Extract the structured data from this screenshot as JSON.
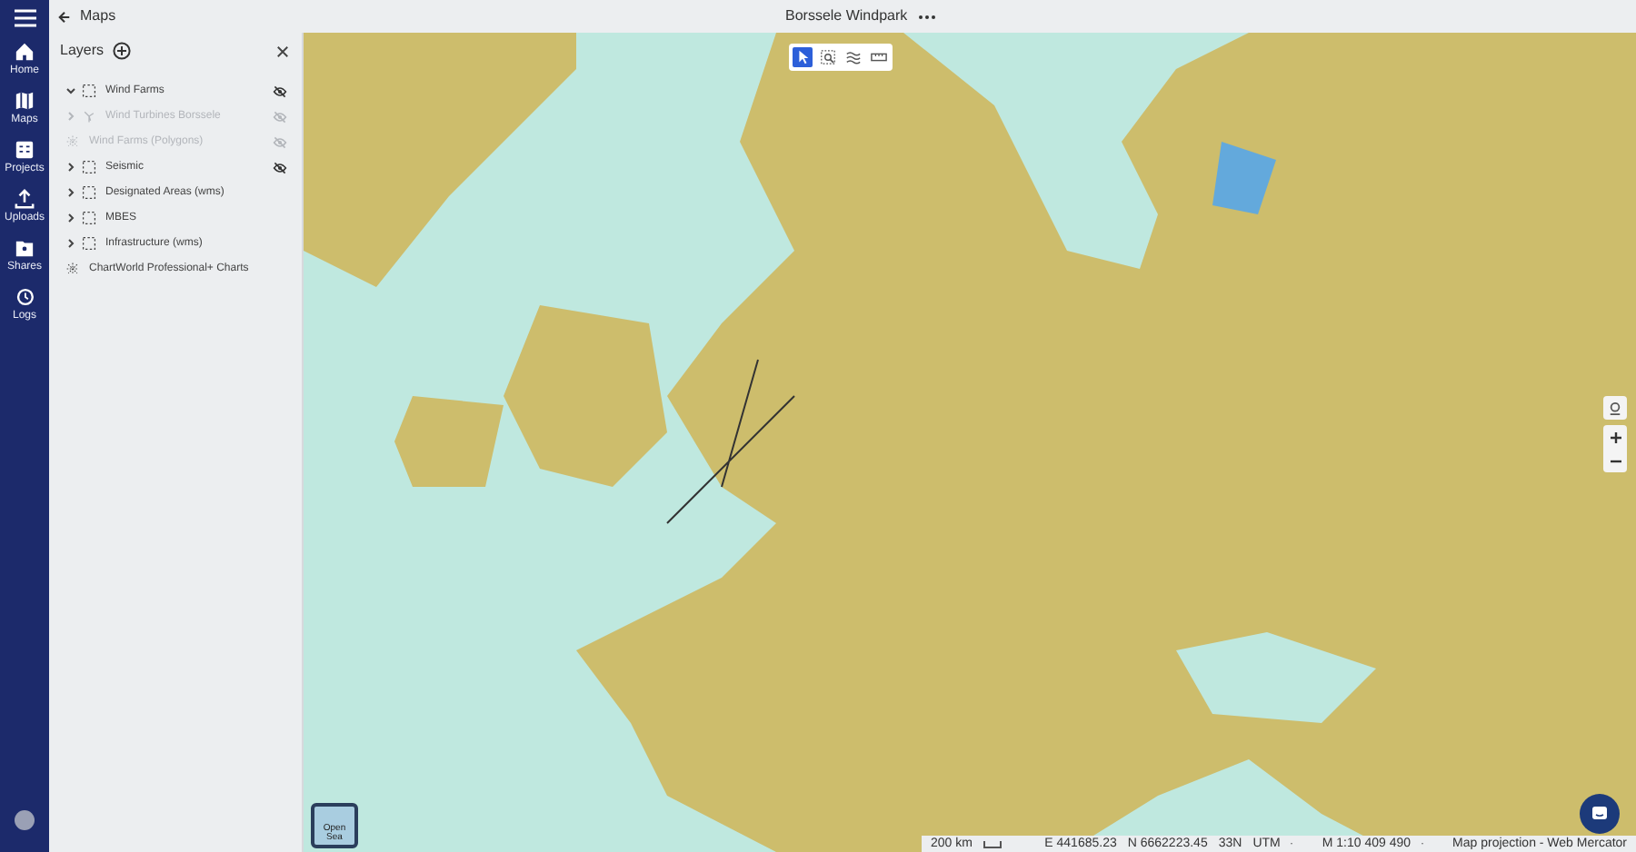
{
  "header": {
    "back_label": "Maps",
    "title": "Borssele Windpark"
  },
  "nav": [
    {
      "label": "Home",
      "kind": "home"
    },
    {
      "label": "Maps",
      "kind": "map"
    },
    {
      "label": "Projects",
      "kind": "projects"
    },
    {
      "label": "Uploads",
      "kind": "upload"
    },
    {
      "label": "Shares",
      "kind": "share"
    },
    {
      "label": "Logs",
      "kind": "history"
    }
  ],
  "layers_panel": {
    "title": "Layers",
    "items": [
      {
        "label": "Wind Farms",
        "kind": "layer",
        "expanded": true,
        "disabled": false,
        "hidden": true
      },
      {
        "label": "Wind Turbines Borssele",
        "kind": "point",
        "expanded": false,
        "disabled": true,
        "hidden": true
      },
      {
        "label": "Wind Farms (Polygons)",
        "kind": "chart",
        "disabled": true,
        "hidden": true
      },
      {
        "label": "Seismic",
        "kind": "layer",
        "expanded": false,
        "disabled": false,
        "hidden": true
      },
      {
        "label": "Designated Areas (wms)",
        "kind": "layer",
        "expanded": false,
        "disabled": false,
        "hidden": false
      },
      {
        "label": "MBES",
        "kind": "layer",
        "expanded": false,
        "disabled": false,
        "hidden": false
      },
      {
        "label": "Infrastructure (wms)",
        "kind": "layer",
        "expanded": false,
        "disabled": false,
        "hidden": false
      },
      {
        "label": "ChartWorld Professional+ Charts",
        "kind": "chart",
        "disabled": false,
        "hidden": false
      }
    ]
  },
  "map_tools": [
    {
      "kind": "select",
      "selected": true
    },
    {
      "kind": "zoom-box",
      "selected": false
    },
    {
      "kind": "waves",
      "selected": false
    },
    {
      "kind": "ruler",
      "selected": false
    }
  ],
  "basemap": {
    "label": "Open Sea"
  },
  "status_bar": {
    "scale": "200 km",
    "easting": "E 441685.23",
    "northing": "N 6662223.45",
    "zone": "33N",
    "crs": "UTM",
    "map_scale": "M 1:10 409 490",
    "projection": "Map projection - Web Mercator"
  }
}
